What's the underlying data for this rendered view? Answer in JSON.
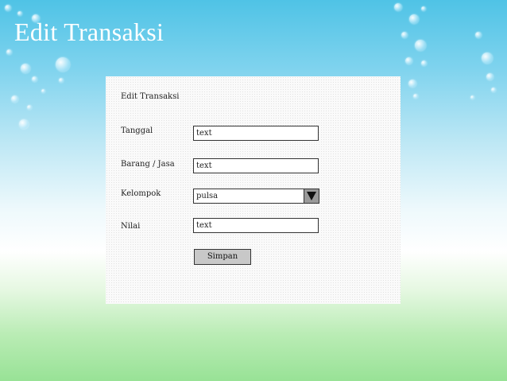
{
  "slide": {
    "title": "Edit Transaksi"
  },
  "form": {
    "title": "Edit Transaksi",
    "fields": [
      {
        "label": "Tanggal",
        "value": "text"
      },
      {
        "label": "Barang / Jasa",
        "value": "text"
      },
      {
        "label": "Kelompok",
        "value": "pulsa"
      },
      {
        "label": "Nilai",
        "value": "text"
      }
    ],
    "submit_label": "Simpan"
  },
  "icons": {
    "dropdown": "triangle-down-icon"
  },
  "colors": {
    "sky": "#4fc3e6",
    "grass": "#98e296",
    "button": "#c8c8c8"
  }
}
